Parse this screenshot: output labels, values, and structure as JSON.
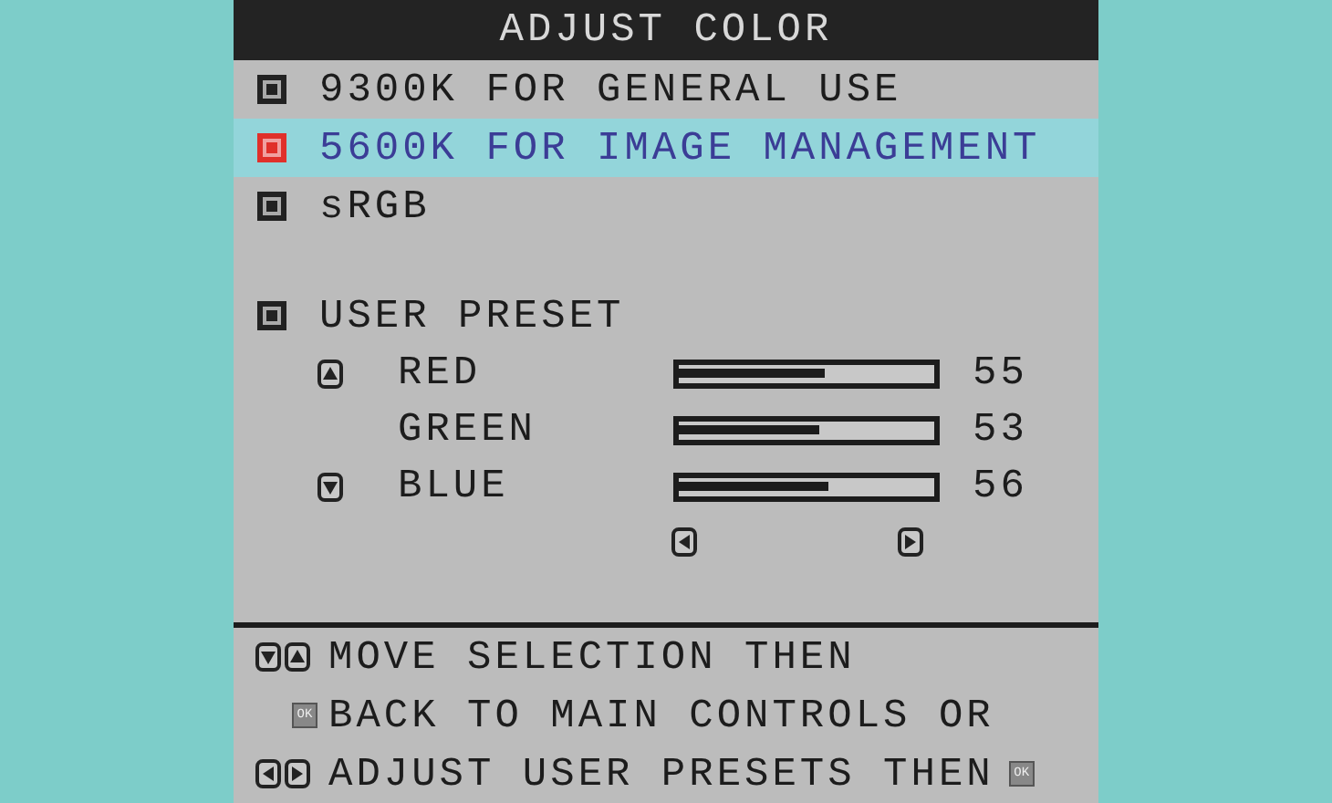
{
  "title": "ADJUST COLOR",
  "presets": [
    {
      "label": "9300K FOR GENERAL USE",
      "selected": false
    },
    {
      "label": "5600K FOR IMAGE MANAGEMENT",
      "selected": true
    },
    {
      "label": "sRGB",
      "selected": false
    }
  ],
  "user_preset": {
    "label": "USER PRESET",
    "selected": false,
    "channels": [
      {
        "name": "RED",
        "level": 0.55,
        "reading": "55"
      },
      {
        "name": "GREEN",
        "level": 0.53,
        "reading": "53"
      },
      {
        "name": "BLUE",
        "level": 0.56,
        "reading": "56"
      }
    ]
  },
  "help": [
    {
      "kind": "up-down",
      "text": "MOVE SELECTION THEN"
    },
    {
      "kind": "ok",
      "key_label": "OK",
      "text": "BACK TO MAIN CONTROLS OR"
    },
    {
      "kind": "left-right",
      "text": "ADJUST USER PRESETS THEN",
      "end_key_label": "OK"
    }
  ]
}
